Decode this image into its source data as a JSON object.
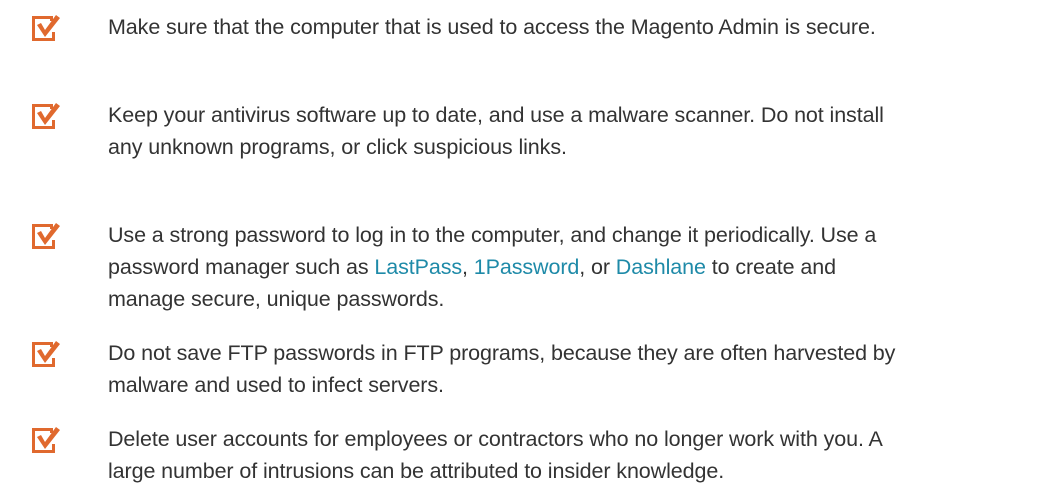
{
  "accent_color": "#e0692e",
  "link_color": "#1e8aa8",
  "icon": "checked-box-icon",
  "items": [
    {
      "lines": [
        "Make sure that the computer that is used to access the Magento Admin is secure."
      ]
    },
    {
      "lines": [
        "Keep your antivirus software up to date, and use a malware scanner. Do not install",
        "any unknown programs, or click suspicious links."
      ]
    },
    {
      "line1": "Use a strong password to log in to the computer, and change it periodically. Use a",
      "line2": {
        "before": "password manager such as ",
        "link1": "LastPass",
        "sep1": ", ",
        "link2": "1Password",
        "sep2": ", or ",
        "link3": "Dashlane",
        "after": " to create and"
      },
      "line3": "manage secure, unique passwords."
    },
    {
      "lines": [
        "Do not save FTP passwords in FTP programs, because they are often harvested by",
        "malware and used to infect servers."
      ]
    },
    {
      "lines": [
        "Delete user accounts for employees or contractors who no longer work with you. A",
        "large number of intrusions can be attributed to insider knowledge."
      ]
    }
  ]
}
